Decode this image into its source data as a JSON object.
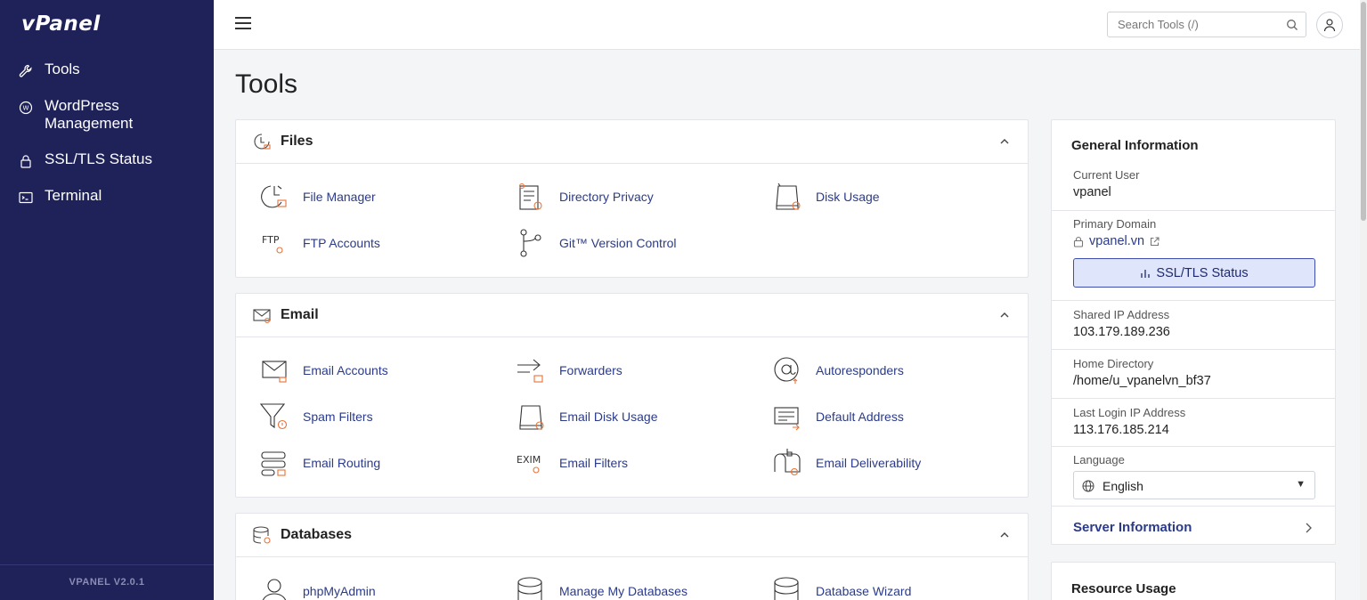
{
  "app": {
    "logo": "vPanel",
    "version": "VPANEL V2.0.1"
  },
  "sidebar": {
    "items": [
      {
        "label": "Tools",
        "icon": "wrench-icon"
      },
      {
        "label": "WordPress Management",
        "icon": "wordpress-icon"
      },
      {
        "label": "SSL/TLS Status",
        "icon": "lock-icon"
      },
      {
        "label": "Terminal",
        "icon": "terminal-icon"
      }
    ]
  },
  "header": {
    "search_placeholder": "Search Tools (/)"
  },
  "page": {
    "title": "Tools"
  },
  "sections": [
    {
      "title": "Files",
      "tools": [
        "File Manager",
        "Directory Privacy",
        "Disk Usage",
        "FTP Accounts",
        "Git™ Version Control"
      ]
    },
    {
      "title": "Email",
      "tools": [
        "Email Accounts",
        "Forwarders",
        "Autoresponders",
        "Spam Filters",
        "Email Disk Usage",
        "Default Address",
        "Email Routing",
        "Email Filters",
        "Email Deliverability"
      ]
    },
    {
      "title": "Databases",
      "tools": [
        "phpMyAdmin",
        "Manage My Databases",
        "Database Wizard"
      ]
    }
  ],
  "icon_text": {
    "ftp": "FTP",
    "exim": "EXIM"
  },
  "general_info": {
    "title": "General Information",
    "current_user_label": "Current User",
    "current_user": "vpanel",
    "primary_domain_label": "Primary Domain",
    "primary_domain": "vpanel.vn",
    "ssl_button": "SSL/TLS Status",
    "shared_ip_label": "Shared IP Address",
    "shared_ip": "103.179.189.236",
    "home_dir_label": "Home Directory",
    "home_dir": "/home/u_vpanelvn_bf37",
    "last_login_label": "Last Login IP Address",
    "last_login": "113.176.185.214",
    "language_label": "Language",
    "language": "English",
    "server_info": "Server Information"
  },
  "resource_usage": {
    "title": "Resource Usage"
  },
  "colors": {
    "sidebar": "#1f2259",
    "link": "#2b3b8a",
    "accent": "#e8733a"
  }
}
